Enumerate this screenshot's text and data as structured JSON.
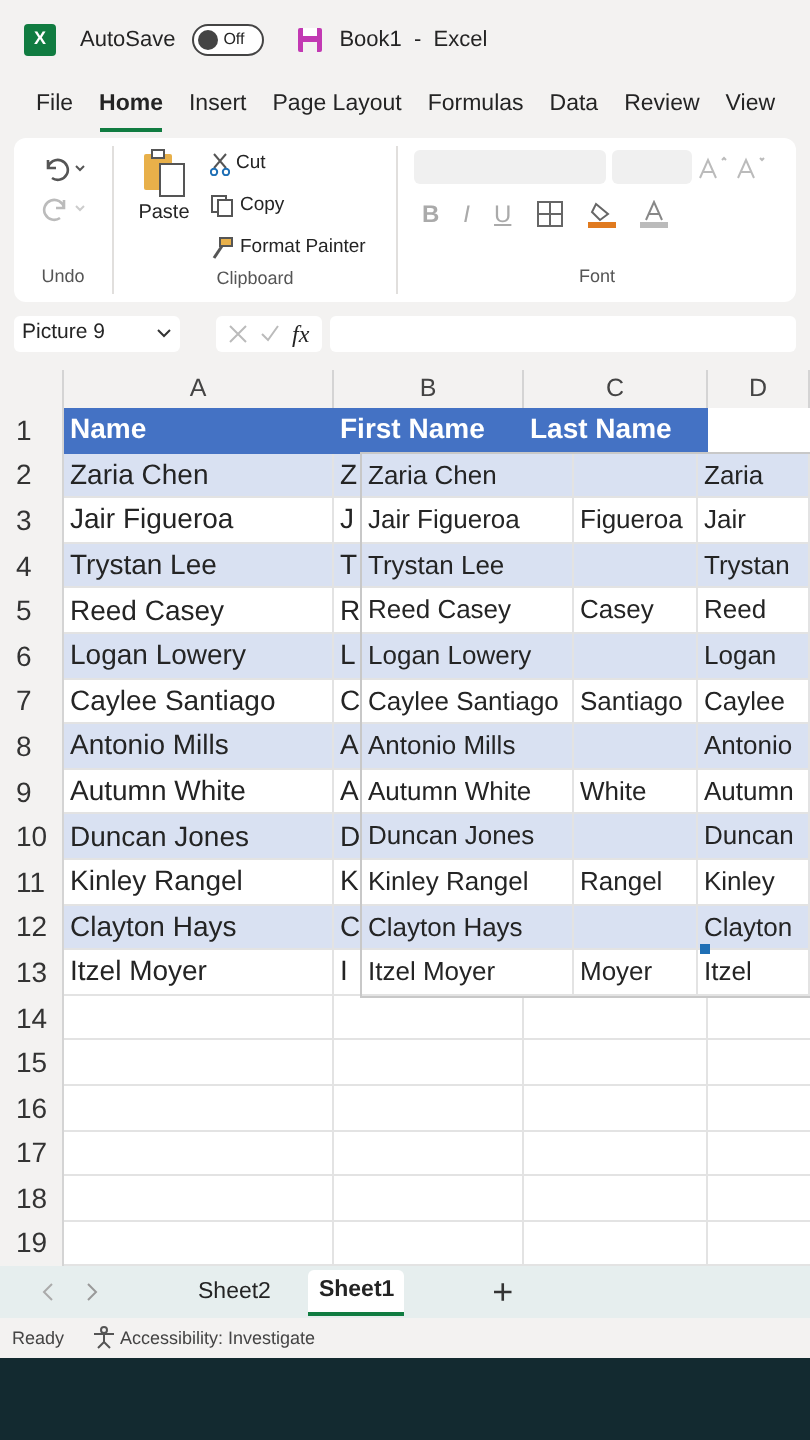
{
  "title_bar": {
    "app_badge": "X",
    "autosave_label": "AutoSave",
    "autosave": {
      "on": false,
      "label": "Off"
    },
    "document_title": "Book1  -  Excel"
  },
  "ribbon_tabs": [
    {
      "label": "File",
      "selected": false
    },
    {
      "label": "Home",
      "selected": true
    },
    {
      "label": "Insert",
      "selected": false
    },
    {
      "label": "Page Layout",
      "selected": false
    },
    {
      "label": "Formulas",
      "selected": false
    },
    {
      "label": "Data",
      "selected": false
    },
    {
      "label": "Review",
      "selected": false
    },
    {
      "label": "View",
      "selected": false
    }
  ],
  "ribbon": {
    "undo_label": "Undo",
    "paste": "Paste",
    "cut": "Cut",
    "copy": "Copy",
    "format_painter": "Format Painter",
    "clipboard_label": "Clipboard",
    "bold": "B",
    "italic": "I",
    "underline": "U",
    "font_label": "Font"
  },
  "formula_bar": {
    "name_box": "Picture 9",
    "fx": "fx"
  },
  "columns": [
    "A",
    "B",
    "C",
    "D"
  ],
  "rows": [
    {
      "number": "1",
      "a": "Name",
      "b": "First Name",
      "c": "Last Name",
      "header": true,
      "banded": false
    },
    {
      "number": "2",
      "a": "Zaria Chen",
      "b": "Z",
      "header": false,
      "banded": true
    },
    {
      "number": "3",
      "a": "Jair Figueroa",
      "b": "J",
      "header": false,
      "banded": false
    },
    {
      "number": "4",
      "a": "Trystan Lee",
      "b": "T",
      "header": false,
      "banded": true
    },
    {
      "number": "5",
      "a": "Reed Casey",
      "b": "R",
      "header": false,
      "banded": false
    },
    {
      "number": "6",
      "a": "Logan Lowery",
      "b": "L",
      "header": false,
      "banded": true
    },
    {
      "number": "7",
      "a": "Caylee Santiago",
      "b": "C",
      "header": false,
      "banded": false
    },
    {
      "number": "8",
      "a": "Antonio Mills",
      "b": "A",
      "header": false,
      "banded": true
    },
    {
      "number": "9",
      "a": "Autumn White",
      "b": "A",
      "header": false,
      "banded": false
    },
    {
      "number": "10",
      "a": "Duncan Jones",
      "b": "D",
      "header": false,
      "banded": true
    },
    {
      "number": "11",
      "a": "Kinley Rangel",
      "b": "K",
      "header": false,
      "banded": false
    },
    {
      "number": "12",
      "a": "Clayton Hays",
      "b": "C",
      "header": false,
      "banded": true
    },
    {
      "number": "13",
      "a": "Itzel Moyer",
      "b": "I",
      "header": false,
      "banded": false
    },
    {
      "number": "14"
    },
    {
      "number": "15"
    },
    {
      "number": "16"
    },
    {
      "number": "17"
    },
    {
      "number": "18"
    },
    {
      "number": "19"
    }
  ],
  "picture_table": [
    {
      "full": "Zaria Chen",
      "first": "Zaria",
      "banded": true
    },
    {
      "full": "Jair Figueroa",
      "middle": "Figueroa",
      "first": "Jair",
      "banded": false
    },
    {
      "full": "Trystan Lee",
      "first": "Trystan",
      "banded": true
    },
    {
      "full": "Reed Casey",
      "middle": "Casey",
      "first": "Reed",
      "banded": false
    },
    {
      "full": "Logan Lowery",
      "first": "Logan",
      "banded": true
    },
    {
      "full": "Caylee Santiago",
      "middle": "Santiago",
      "first": "Caylee",
      "banded": false
    },
    {
      "full": "Antonio Mills",
      "first": "Antonio",
      "banded": true
    },
    {
      "full": "Autumn White",
      "middle": "White",
      "first": "Autumn",
      "banded": false
    },
    {
      "full": "Duncan Jones",
      "first": "Duncan",
      "banded": true
    },
    {
      "full": "Kinley Rangel",
      "middle": "Rangel",
      "first": "Kinley",
      "banded": false
    },
    {
      "full": "Clayton Hays",
      "first": "Clayton",
      "banded": true
    },
    {
      "full": "Itzel Moyer",
      "middle": "Moyer",
      "first": "Itzel",
      "banded": false
    }
  ],
  "sheet_tabs": [
    {
      "label": "Sheet2",
      "selected": false
    },
    {
      "label": "Sheet1",
      "selected": true
    }
  ],
  "add_sheet": "+",
  "status_bar": {
    "ready": "Ready",
    "accessibility": "Accessibility: Investigate"
  }
}
